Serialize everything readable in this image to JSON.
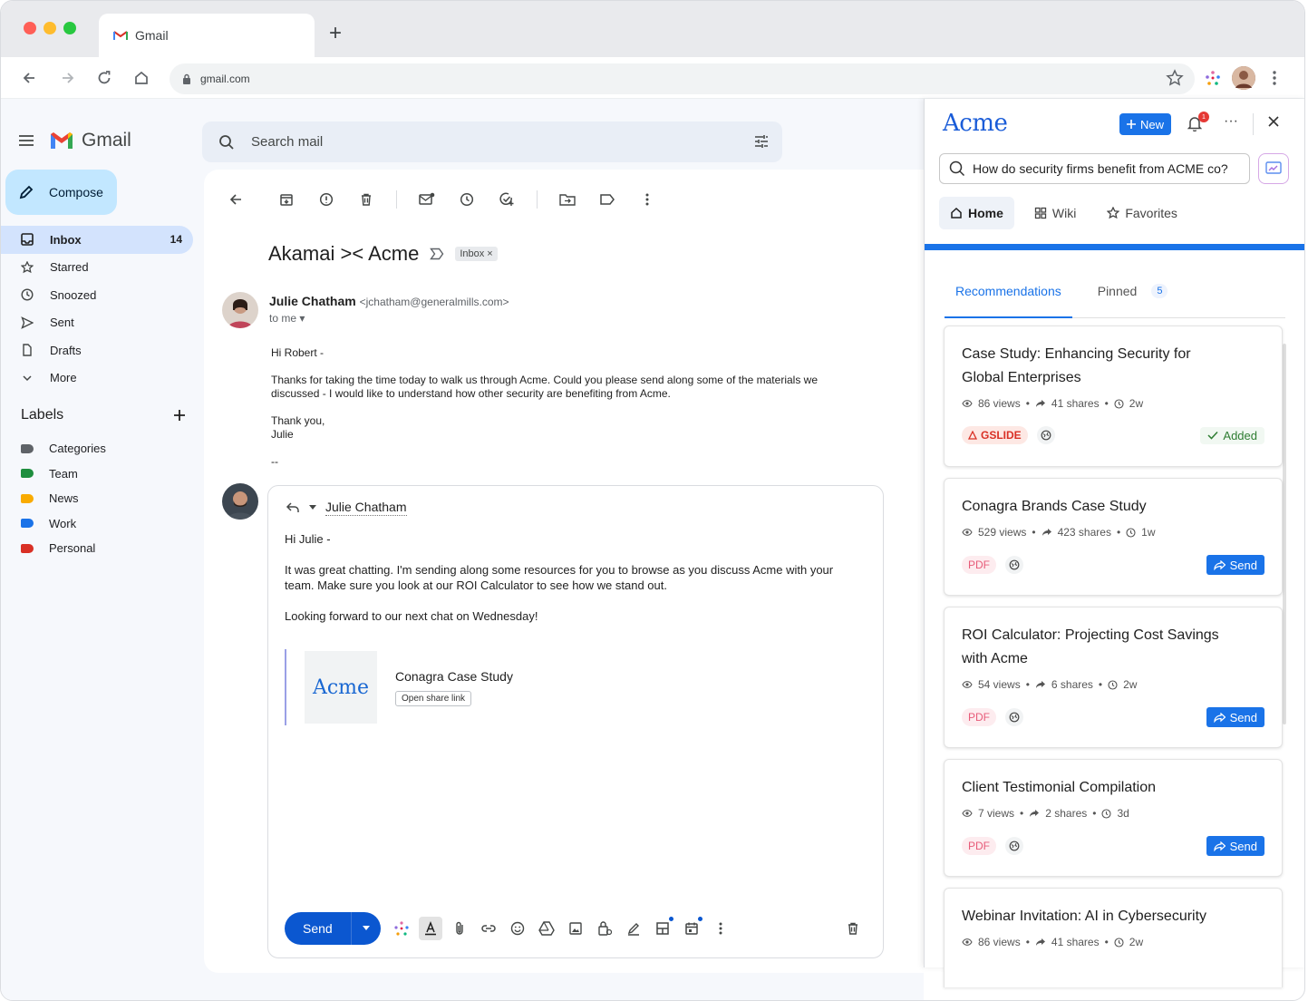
{
  "browser": {
    "tab_title": "Gmail",
    "url": "gmail.com",
    "traffic_colors": [
      "#ff5f57",
      "#febc2e",
      "#28c840"
    ]
  },
  "gmail": {
    "logo_text": "Gmail",
    "compose_label": "Compose",
    "search_placeholder": "Search mail",
    "nav": [
      {
        "label": "Inbox",
        "count": "14",
        "icon": "inbox-icon"
      },
      {
        "label": "Starred",
        "icon": "star-icon"
      },
      {
        "label": "Snoozed",
        "icon": "clock-icon"
      },
      {
        "label": "Sent",
        "icon": "send-icon"
      },
      {
        "label": "Drafts",
        "icon": "draft-icon"
      },
      {
        "label": "More",
        "icon": "chevron-down-icon"
      }
    ],
    "labels_heading": "Labels",
    "labels": [
      {
        "name": "Categories",
        "color": "#5f6368"
      },
      {
        "name": "Team",
        "color": "#1e8e3e"
      },
      {
        "name": "News",
        "color": "#f9ab00"
      },
      {
        "name": "Work",
        "color": "#1a73e8"
      },
      {
        "name": "Personal",
        "color": "#d93025"
      }
    ]
  },
  "email": {
    "subject": "Akamai >< Acme",
    "folder_chip": "Inbox ×",
    "sender_name": "Julie Chatham",
    "sender_email": "<jchatham@generalmills.com>",
    "to": "to me ▾",
    "body": [
      "Hi Robert -",
      "Thanks for taking the time today to walk us through Acme. Could you please send along some of the materials we discussed - I would like to understand how other security are benefiting from Acme.",
      "Thank you,\nJulie",
      "--"
    ]
  },
  "reply": {
    "to_name": "Julie Chatham",
    "body": [
      "Hi Julie -",
      "It was great chatting. I'm sending along some resources for you to browse as you discuss Acme with your team. Make sure you look at our ROI Calculator to see how we stand out.",
      "Looking forward to our next chat on Wednesday!"
    ],
    "attachment": {
      "thumb_text": "Acme",
      "title": "Conagra Case Study",
      "link_label": "Open share link"
    },
    "send_label": "Send"
  },
  "panel": {
    "logo": "Acme",
    "new_label": "New",
    "notif_count": "1",
    "search_value": "How do security firms benefit from ACME co?",
    "tabs": [
      "Home",
      "Wiki",
      "Favorites"
    ],
    "subtabs": {
      "recommendations": "Recommendations",
      "pinned": "Pinned",
      "pinned_count": "5"
    },
    "cards": [
      {
        "title": "Case Study: Enhancing Security for Global Enterprises",
        "views": "86 views",
        "shares": "41 shares",
        "age": "2w",
        "type": "GSLIDE",
        "action": "Added"
      },
      {
        "title": "Conagra Brands Case Study",
        "views": "529 views",
        "shares": "423 shares",
        "age": "1w",
        "type": "PDF",
        "action": "Send"
      },
      {
        "title": "ROI Calculator: Projecting Cost Savings with Acme",
        "views": "54 views",
        "shares": "6 shares",
        "age": "2w",
        "type": "PDF",
        "action": "Send"
      },
      {
        "title": "Client Testimonial Compilation",
        "views": "7 views",
        "shares": "2 shares",
        "age": "3d",
        "type": "PDF",
        "action": "Send"
      },
      {
        "title": "Webinar Invitation: AI in Cybersecurity",
        "views": "86 views",
        "shares": "41 shares",
        "age": "2w"
      }
    ]
  }
}
